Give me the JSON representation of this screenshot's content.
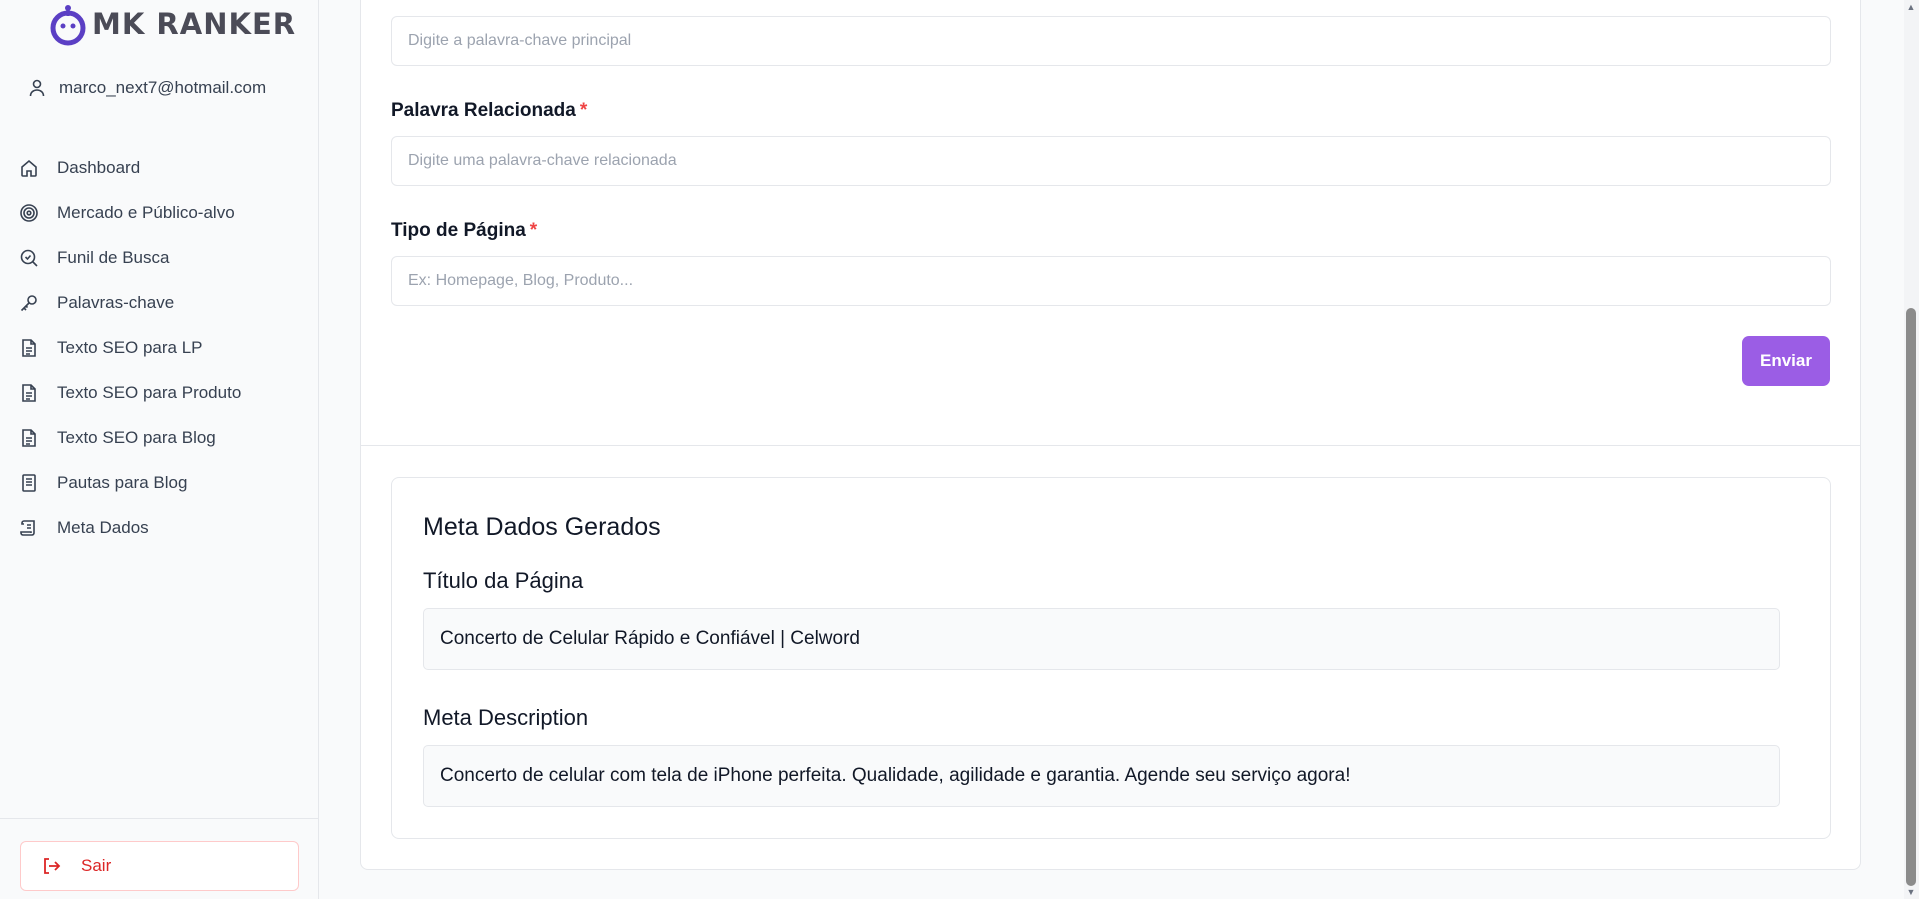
{
  "app": {
    "logo_text": "MK RANKER"
  },
  "user": {
    "email": "marco_next7@hotmail.com"
  },
  "sidebar": {
    "items": [
      {
        "label": "Dashboard",
        "icon": "home-icon"
      },
      {
        "label": "Mercado e Público-alvo",
        "icon": "target-icon"
      },
      {
        "label": "Funil de Busca",
        "icon": "search-check-icon"
      },
      {
        "label": "Palavras-chave",
        "icon": "key-icon"
      },
      {
        "label": "Texto SEO para LP",
        "icon": "document-icon"
      },
      {
        "label": "Texto SEO para Produto",
        "icon": "document-icon"
      },
      {
        "label": "Texto SEO para Blog",
        "icon": "document-icon"
      },
      {
        "label": "Pautas para Blog",
        "icon": "notebook-icon"
      },
      {
        "label": "Meta Dados",
        "icon": "scroll-icon"
      }
    ],
    "logout_label": "Sair"
  },
  "form": {
    "main_keyword": {
      "placeholder": "Digite a palavra-chave principal",
      "value": ""
    },
    "related_keyword": {
      "label": "Palavra Relacionada",
      "required_mark": "*",
      "placeholder": "Digite uma palavra-chave relacionada",
      "value": ""
    },
    "page_type": {
      "label": "Tipo de Página",
      "required_mark": "*",
      "placeholder": "Ex: Homepage, Blog, Produto...",
      "value": ""
    },
    "submit_label": "Enviar"
  },
  "result": {
    "title": "Meta Dados Gerados",
    "page_title_label": "Título da Página",
    "page_title_value": "Concerto de Celular Rápido e Confiável | Celword",
    "meta_description_label": "Meta Description",
    "meta_description_value": "Concerto de celular com tela de iPhone perfeita. Qualidade, agilidade e garantia. Agende seu serviço agora!"
  },
  "colors": {
    "accent": "#9b5de5",
    "brand": "#5b3fc4",
    "danger": "#dc2626",
    "required": "#ef4444"
  }
}
